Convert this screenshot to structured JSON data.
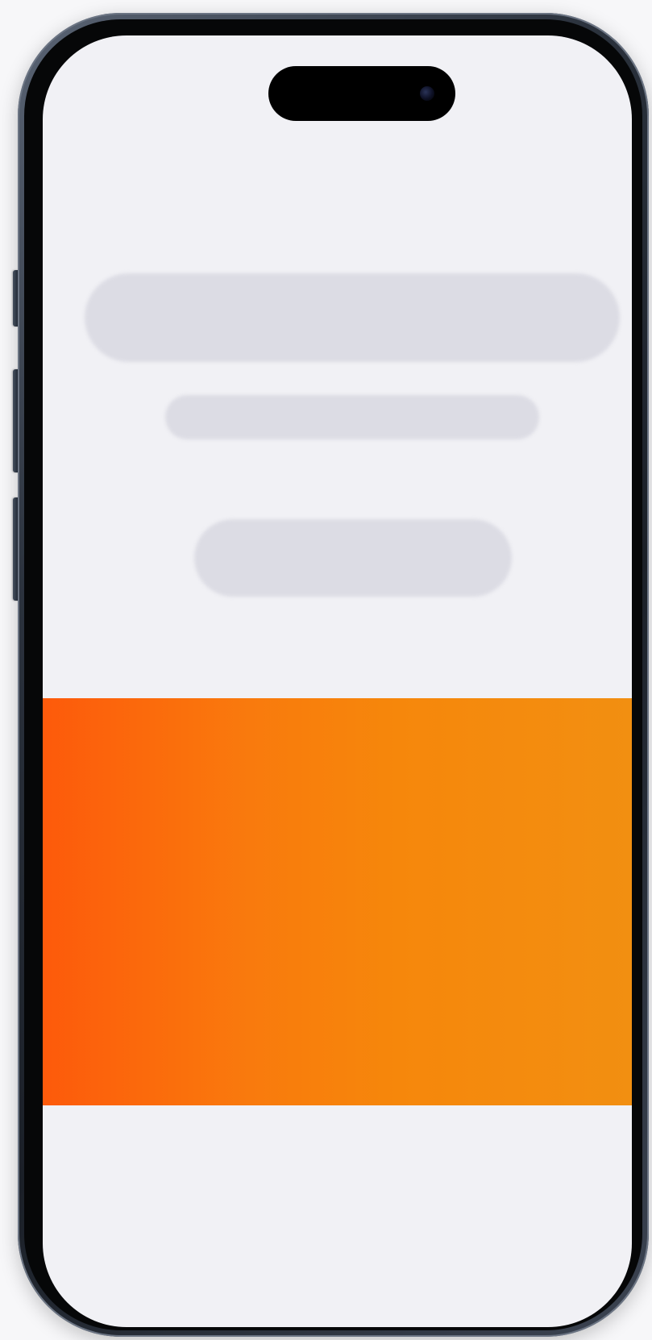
{
  "device": {
    "model": "phone",
    "frame_color": "#2b323d",
    "screen_background": "#f1f1f5"
  },
  "screen": {
    "state": "loading",
    "placeholders": [
      "title",
      "subtitle",
      "button"
    ],
    "placeholder_color": "#dcdce4"
  },
  "banner": {
    "gradient_start": "#fd5a0b",
    "gradient_end": "#f28f11"
  }
}
